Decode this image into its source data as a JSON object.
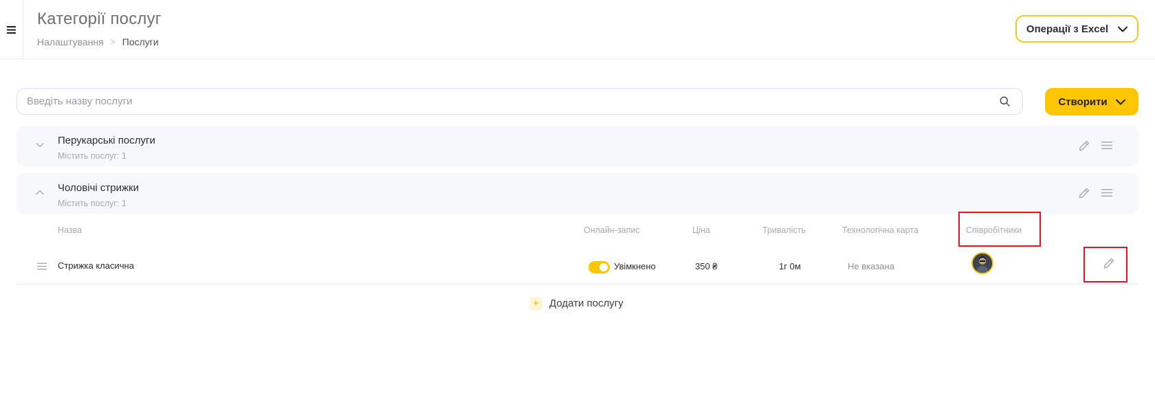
{
  "header": {
    "title": "Категорії послуг",
    "breadcrumb": {
      "parent": "Налаштування",
      "separator": ">",
      "current": "Послуги"
    },
    "excel_button": "Операції з Excel"
  },
  "search": {
    "placeholder": "Введіть назву послуги",
    "value": ""
  },
  "create_button": "Створити",
  "categories": [
    {
      "name": "Перукарські послуги",
      "count_label": "Містить послуг: 1",
      "expanded": false
    },
    {
      "name": "Чоловічі стрижки",
      "count_label": "Містить послуг: 1",
      "expanded": true
    }
  ],
  "table": {
    "columns": {
      "name": "Назва",
      "online": "Онлайн-запис",
      "price": "Ціна",
      "duration": "Тривалість",
      "tech_card": "Технологічна карта",
      "staff": "Співробітники"
    },
    "rows": [
      {
        "name": "Стрижка класична",
        "online_enabled": true,
        "online_label": "Увімкнено",
        "price": "350 ₴",
        "duration": "1г 0м",
        "tech_card": "Не вказана"
      }
    ]
  },
  "add_service": {
    "icon": "+",
    "label": "Додати послугу"
  },
  "colors": {
    "accent": "#fdc600",
    "highlight": "#e8121a",
    "category_bg": "#f7f8fb"
  },
  "icons": {
    "menu": "hamburger-icon",
    "search": "search-icon",
    "chevron": "chevron-down-icon",
    "edit": "pencil-icon",
    "drag": "drag-handle-icon"
  }
}
